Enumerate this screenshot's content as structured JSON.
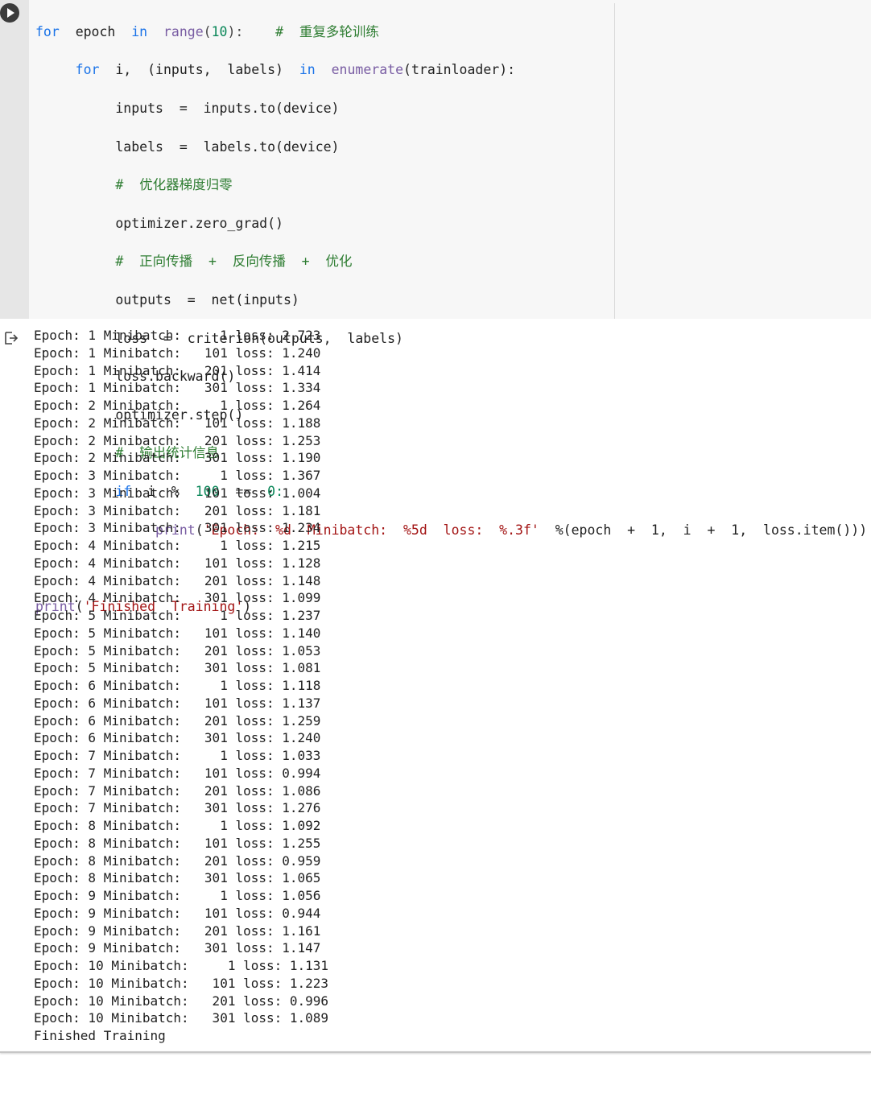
{
  "code": {
    "l1": {
      "kw_for": "for",
      "v_epoch": "epoch",
      "kw_in": "in",
      "fn_range": "range",
      "open": "(",
      "n10": "10",
      "close": "):",
      "cm": "#  重复多轮训练"
    },
    "l2": {
      "kw_for": "for",
      "rest": "i,  (inputs,  labels)",
      "kw_in": "in",
      "fn": "enumerate",
      "tail": "(trainloader):"
    },
    "l3": "inputs  =  inputs.to(device)",
    "l4": "labels  =  labels.to(device)",
    "l5": "#  优化器梯度归零",
    "l6": "optimizer.zero_grad()",
    "l7": "#  正向传播  +  反向传播  +  优化",
    "l8": "outputs  =  net(inputs)",
    "l9": "loss  =  criterion(outputs,  labels)",
    "l10": "loss.backward()",
    "l11": "optimizer.step()",
    "l12": "#  输出统计信息",
    "l13": {
      "kw_if": "if",
      "mid": "i  %",
      "n100": "100",
      "eq": "==",
      "n0": "0:"
    },
    "l14": {
      "fn": "print",
      "open": "(",
      "str": "'Epoch:  %d  Minibatch:  %5d  loss:  %.3f'",
      "tail": "  %(epoch  +  1,  i  +  1,  loss.item()))"
    },
    "l16": {
      "fn": "print",
      "open": "(",
      "str": "'Finished  Training'",
      "close": ")"
    }
  },
  "output_lines": [
    "Epoch: 1 Minibatch:     1 loss: 2.723",
    "Epoch: 1 Minibatch:   101 loss: 1.240",
    "Epoch: 1 Minibatch:   201 loss: 1.414",
    "Epoch: 1 Minibatch:   301 loss: 1.334",
    "Epoch: 2 Minibatch:     1 loss: 1.264",
    "Epoch: 2 Minibatch:   101 loss: 1.188",
    "Epoch: 2 Minibatch:   201 loss: 1.253",
    "Epoch: 2 Minibatch:   301 loss: 1.190",
    "Epoch: 3 Minibatch:     1 loss: 1.367",
    "Epoch: 3 Minibatch:   101 loss: 1.004",
    "Epoch: 3 Minibatch:   201 loss: 1.181",
    "Epoch: 3 Minibatch:   301 loss: 1.234",
    "Epoch: 4 Minibatch:     1 loss: 1.215",
    "Epoch: 4 Minibatch:   101 loss: 1.128",
    "Epoch: 4 Minibatch:   201 loss: 1.148",
    "Epoch: 4 Minibatch:   301 loss: 1.099",
    "Epoch: 5 Minibatch:     1 loss: 1.237",
    "Epoch: 5 Minibatch:   101 loss: 1.140",
    "Epoch: 5 Minibatch:   201 loss: 1.053",
    "Epoch: 5 Minibatch:   301 loss: 1.081",
    "Epoch: 6 Minibatch:     1 loss: 1.118",
    "Epoch: 6 Minibatch:   101 loss: 1.137",
    "Epoch: 6 Minibatch:   201 loss: 1.259",
    "Epoch: 6 Minibatch:   301 loss: 1.240",
    "Epoch: 7 Minibatch:     1 loss: 1.033",
    "Epoch: 7 Minibatch:   101 loss: 0.994",
    "Epoch: 7 Minibatch:   201 loss: 1.086",
    "Epoch: 7 Minibatch:   301 loss: 1.276",
    "Epoch: 8 Minibatch:     1 loss: 1.092",
    "Epoch: 8 Minibatch:   101 loss: 1.255",
    "Epoch: 8 Minibatch:   201 loss: 0.959",
    "Epoch: 8 Minibatch:   301 loss: 1.065",
    "Epoch: 9 Minibatch:     1 loss: 1.056",
    "Epoch: 9 Minibatch:   101 loss: 0.944",
    "Epoch: 9 Minibatch:   201 loss: 1.161",
    "Epoch: 9 Minibatch:   301 loss: 1.147",
    "Epoch: 10 Minibatch:     1 loss: 1.131",
    "Epoch: 10 Minibatch:   101 loss: 1.223",
    "Epoch: 10 Minibatch:   201 loss: 0.996",
    "Epoch: 10 Minibatch:   301 loss: 1.089",
    "Finished Training"
  ],
  "icons": {
    "run": "play-icon",
    "output": "output-arrow-icon"
  }
}
